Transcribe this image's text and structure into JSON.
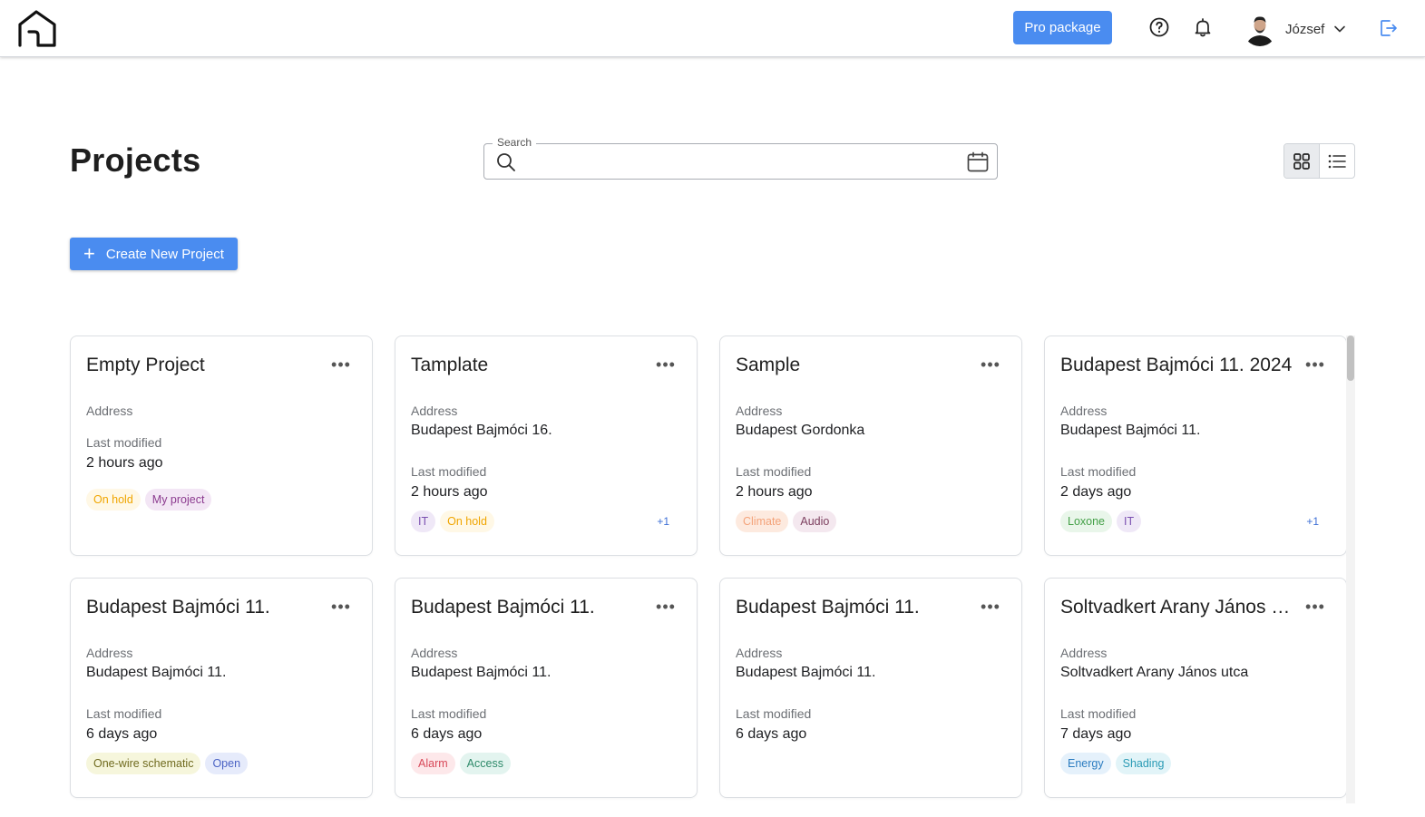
{
  "header": {
    "pro_label": "Pro package",
    "user_name": "József"
  },
  "page": {
    "title": "Projects",
    "create_label": "Create New Project"
  },
  "search": {
    "label": "Search",
    "value": "",
    "placeholder": ""
  },
  "view_mode": "grid",
  "cards": [
    {
      "title": "Empty Project",
      "address_label": "Address",
      "address": "",
      "modified_label": "Last modified",
      "modified": "2 hours ago",
      "tags": [
        {
          "text": "On hold",
          "bg": "#fff8e6",
          "fg": "#f0a500"
        },
        {
          "text": "My project",
          "bg": "#f3e6f5",
          "fg": "#8b3a8f"
        }
      ],
      "more": ""
    },
    {
      "title": "Tamplate",
      "address_label": "Address",
      "address": "Budapest Bajmóci 16.",
      "modified_label": "Last modified",
      "modified": "2 hours ago",
      "tags": [
        {
          "text": "IT",
          "bg": "#efe8f7",
          "fg": "#7a4fb0"
        },
        {
          "text": "On hold",
          "bg": "#fff8e6",
          "fg": "#f0a500"
        }
      ],
      "more": "+1"
    },
    {
      "title": "Sample",
      "address_label": "Address",
      "address": "Budapest Gordonka",
      "modified_label": "Last modified",
      "modified": "2 hours ago",
      "tags": [
        {
          "text": "Climate",
          "bg": "#fdeadf",
          "fg": "#f4a37a"
        },
        {
          "text": "Audio",
          "bg": "#f4e8ef",
          "fg": "#7d3f5f"
        }
      ],
      "more": ""
    },
    {
      "title": "Budapest Bajmóci 11. 2024",
      "address_label": "Address",
      "address": "Budapest Bajmóci 11.",
      "modified_label": "Last modified",
      "modified": "2 days ago",
      "tags": [
        {
          "text": "Loxone",
          "bg": "#e9f6ea",
          "fg": "#43a047"
        },
        {
          "text": "IT",
          "bg": "#efe8f7",
          "fg": "#7a4fb0"
        }
      ],
      "more": "+1"
    },
    {
      "title": "Budapest Bajmóci 11.",
      "address_label": "Address",
      "address": "Budapest Bajmóci 11.",
      "modified_label": "Last modified",
      "modified": "6 days ago",
      "tags": [
        {
          "text": "One-wire schematic",
          "bg": "#f6f6dc",
          "fg": "#6f6a1e"
        },
        {
          "text": "Open",
          "bg": "#e6ebfb",
          "fg": "#4b63c4"
        }
      ],
      "more": ""
    },
    {
      "title": "Budapest Bajmóci 11.",
      "address_label": "Address",
      "address": "Budapest Bajmóci 11.",
      "modified_label": "Last modified",
      "modified": "6 days ago",
      "tags": [
        {
          "text": "Alarm",
          "bg": "#fde8ea",
          "fg": "#d84a5a"
        },
        {
          "text": "Access",
          "bg": "#e3f4ef",
          "fg": "#2e8a6a"
        }
      ],
      "more": ""
    },
    {
      "title": "Budapest Bajmóci 11.",
      "address_label": "Address",
      "address": "Budapest Bajmóci 11.",
      "modified_label": "Last modified",
      "modified": "6 days ago",
      "tags": [],
      "more": ""
    },
    {
      "title": "Soltvadkert Arany János utca",
      "address_label": "Address",
      "address": "Soltvadkert Arany János utca",
      "modified_label": "Last modified",
      "modified": "7 days ago",
      "tags": [
        {
          "text": "Energy",
          "bg": "#e5f1fb",
          "fg": "#2b7cc0"
        },
        {
          "text": "Shading",
          "bg": "#e2f4f8",
          "fg": "#2a9bb5"
        }
      ],
      "more": ""
    }
  ],
  "icons": {
    "logo": "home-outline-icon",
    "help": "question-circle-icon",
    "notifications": "bell-icon",
    "logout": "logout-icon",
    "search": "search-icon",
    "calendar": "calendar-icon",
    "grid_view": "grid-icon",
    "list_view": "list-icon"
  }
}
